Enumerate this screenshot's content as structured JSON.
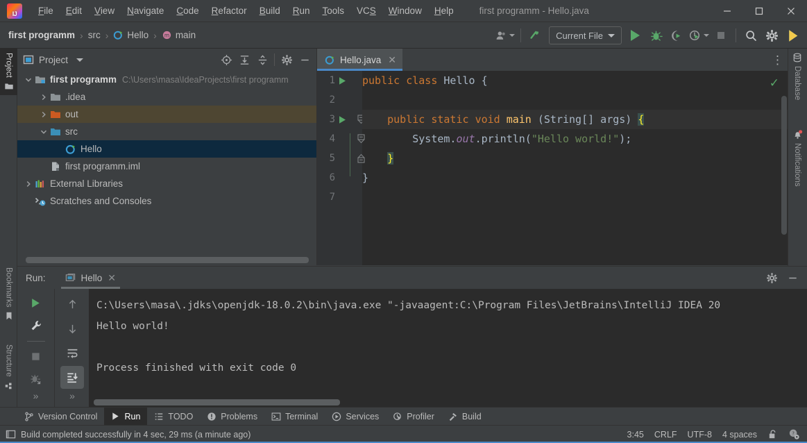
{
  "window": {
    "title": "first programm - Hello.java",
    "logo_icon": "intellij-idea-logo",
    "minimize_icon": "minimize-icon",
    "maximize_icon": "maximize-icon",
    "close_icon": "close-icon"
  },
  "menu": [
    {
      "label": "File",
      "mnemonic": "F"
    },
    {
      "label": "Edit",
      "mnemonic": "E"
    },
    {
      "label": "View",
      "mnemonic": "V"
    },
    {
      "label": "Navigate",
      "mnemonic": "N"
    },
    {
      "label": "Code",
      "mnemonic": "C"
    },
    {
      "label": "Refactor",
      "mnemonic": "R"
    },
    {
      "label": "Build",
      "mnemonic": "B"
    },
    {
      "label": "Run",
      "mnemonic": "R"
    },
    {
      "label": "Tools",
      "mnemonic": "T"
    },
    {
      "label": "VCS",
      "mnemonic": "S"
    },
    {
      "label": "Window",
      "mnemonic": "W"
    },
    {
      "label": "Help",
      "mnemonic": "H"
    }
  ],
  "breadcrumb": {
    "items": [
      "first programm",
      "src",
      "Hello",
      "main"
    ],
    "separator": "›",
    "class_icon": "java-class-icon",
    "method_icon": "method-icon"
  },
  "toolbar": {
    "user_icon": "account-icon",
    "update_icon": "update-project-icon",
    "run_config": "Current File",
    "run_icon": "run-icon",
    "debug_icon": "debug-icon",
    "run_coverage_icon": "run-with-coverage-icon",
    "profiler_icon": "profiler-icon",
    "stop_icon": "stop-icon",
    "search_icon": "search-everywhere-icon",
    "settings_icon": "settings-gear-icon",
    "ai_icon": "ide-features-icon"
  },
  "left_stripe": [
    {
      "label": "Project",
      "icon": "project-folder-icon",
      "active": true
    },
    {
      "label": "Bookmarks",
      "icon": "bookmark-icon",
      "active": false
    },
    {
      "label": "Structure",
      "icon": "structure-icon",
      "active": false
    }
  ],
  "right_stripe": [
    {
      "label": "Database",
      "icon": "database-icon"
    },
    {
      "label": "Notifications",
      "icon": "notifications-bell-icon"
    }
  ],
  "project_panel": {
    "title": "Project",
    "title_icon": "project-view-icon",
    "dropdown_icon": "chevron-down-icon",
    "actions": [
      {
        "name": "select-opened-file",
        "icon": "crosshair-icon"
      },
      {
        "name": "expand-all",
        "icon": "expand-all-icon"
      },
      {
        "name": "collapse-all",
        "icon": "collapse-all-icon"
      },
      {
        "name": "panel-settings",
        "icon": "gear-icon"
      },
      {
        "name": "hide-panel",
        "icon": "minus-icon"
      }
    ],
    "tree": [
      {
        "label": "first programm",
        "path": "C:\\Users\\masa\\IdeaProjects\\first programm",
        "indent": 0,
        "arrow": "expanded",
        "icon": "module-folder-icon",
        "bold": true,
        "state": "normal"
      },
      {
        "label": ".idea",
        "path": "",
        "indent": 1,
        "arrow": "collapsed",
        "icon": "folder-icon",
        "bold": false,
        "state": "normal"
      },
      {
        "label": "out",
        "path": "",
        "indent": 1,
        "arrow": "collapsed",
        "icon": "excluded-folder-icon",
        "bold": false,
        "state": "highlighted"
      },
      {
        "label": "src",
        "path": "",
        "indent": 1,
        "arrow": "expanded",
        "icon": "source-folder-icon",
        "bold": false,
        "state": "normal"
      },
      {
        "label": "Hello",
        "path": "",
        "indent": 2,
        "arrow": "none",
        "icon": "java-class-icon",
        "bold": false,
        "state": "selected"
      },
      {
        "label": "first programm.iml",
        "path": "",
        "indent": 1,
        "arrow": "none",
        "icon": "iml-file-icon",
        "bold": false,
        "state": "normal"
      },
      {
        "label": "External Libraries",
        "path": "",
        "indent": 0,
        "arrow": "collapsed",
        "icon": "libraries-icon",
        "bold": false,
        "state": "normal"
      },
      {
        "label": "Scratches and Consoles",
        "path": "",
        "indent": 0,
        "arrow": "none",
        "icon": "scratches-icon",
        "bold": false,
        "state": "normal"
      }
    ]
  },
  "editor": {
    "tab": {
      "label": "Hello.java",
      "icon": "java-class-icon",
      "close_icon": "close-icon"
    },
    "more_icon": "more-options-icon",
    "inspection_status_icon": "checkmark-ok-icon",
    "lines": [
      {
        "number": "1",
        "gutter_run": true,
        "fold": "none",
        "current": false,
        "tokens": [
          {
            "t": "public",
            "c": "kw"
          },
          {
            "t": " ",
            "c": ""
          },
          {
            "t": "class",
            "c": "kw"
          },
          {
            "t": " ",
            "c": ""
          },
          {
            "t": "Hello",
            "c": "cls"
          },
          {
            "t": " {",
            "c": ""
          }
        ]
      },
      {
        "number": "2",
        "gutter_run": false,
        "fold": "none",
        "current": false,
        "tokens": []
      },
      {
        "number": "3",
        "gutter_run": true,
        "fold": "start",
        "current": true,
        "tokens": [
          {
            "t": "    ",
            "c": ""
          },
          {
            "t": "public",
            "c": "kw"
          },
          {
            "t": " ",
            "c": ""
          },
          {
            "t": "static",
            "c": "kw"
          },
          {
            "t": " ",
            "c": ""
          },
          {
            "t": "void",
            "c": "kw"
          },
          {
            "t": " ",
            "c": ""
          },
          {
            "t": "main",
            "c": "mth"
          },
          {
            "t": " (String[] args) ",
            "c": ""
          },
          {
            "t": "{",
            "c": "brace-hl"
          }
        ]
      },
      {
        "number": "4",
        "gutter_run": false,
        "fold": "mid",
        "current": false,
        "tokens": [
          {
            "t": "        System.",
            "c": ""
          },
          {
            "t": "out",
            "c": "fld"
          },
          {
            "t": ".println(",
            "c": ""
          },
          {
            "t": "\"Hello world!\"",
            "c": "str"
          },
          {
            "t": ");",
            "c": ""
          }
        ]
      },
      {
        "number": "5",
        "gutter_run": false,
        "fold": "end",
        "current": false,
        "tokens": [
          {
            "t": "    ",
            "c": ""
          },
          {
            "t": "}",
            "c": "brace-hl"
          }
        ]
      },
      {
        "number": "6",
        "gutter_run": false,
        "fold": "none",
        "current": false,
        "tokens": [
          {
            "t": "}",
            "c": ""
          }
        ]
      },
      {
        "number": "7",
        "gutter_run": false,
        "fold": "none",
        "current": false,
        "tokens": []
      }
    ]
  },
  "run_panel": {
    "label": "Run:",
    "tab": {
      "label": "Hello",
      "icon": "run-config-icon",
      "close_icon": "close-icon"
    },
    "settings_icon": "gear-icon",
    "hide_icon": "minus-icon",
    "tools_left": [
      {
        "name": "rerun-button",
        "icon": "run-icon"
      },
      {
        "name": "edit-configuration-button",
        "icon": "wrench-icon"
      },
      {
        "name": "stop-button",
        "icon": "stop-icon"
      },
      {
        "name": "dump-threads-button",
        "icon": "thread-dump-icon"
      }
    ],
    "tools_right": [
      {
        "name": "previous-occurrence-button",
        "icon": "arrow-up-icon"
      },
      {
        "name": "next-occurrence-button",
        "icon": "arrow-down-icon"
      },
      {
        "name": "soft-wrap-button",
        "icon": "soft-wrap-icon"
      },
      {
        "name": "scroll-to-end-button",
        "icon": "scroll-to-end-icon",
        "active": true
      }
    ],
    "more_icon": "more-chevrons-icon",
    "console_lines": [
      "C:\\Users\\masa\\.jdks\\openjdk-18.0.2\\bin\\java.exe \"-javaagent:C:\\Program Files\\JetBrains\\IntelliJ IDEA 20",
      "Hello world!",
      "",
      "Process finished with exit code 0"
    ]
  },
  "bottom_bar": [
    {
      "label": "Version Control",
      "icon": "branch-icon",
      "active": false
    },
    {
      "label": "Run",
      "icon": "run-icon",
      "active": true
    },
    {
      "label": "TODO",
      "icon": "todo-list-icon",
      "active": false
    },
    {
      "label": "Problems",
      "icon": "problems-icon",
      "active": false
    },
    {
      "label": "Terminal",
      "icon": "terminal-icon",
      "active": false
    },
    {
      "label": "Services",
      "icon": "services-icon",
      "active": false
    },
    {
      "label": "Profiler",
      "icon": "profiler-icon",
      "active": false
    },
    {
      "label": "Build",
      "icon": "build-hammer-icon",
      "active": false
    }
  ],
  "status_bar": {
    "message_icon": "toggle-toolwindows-icon",
    "message": "Build completed successfully in 4 sec, 29 ms (a minute ago)",
    "caret_position": "3:45",
    "line_separator": "CRLF",
    "encoding": "UTF-8",
    "indent": "4 spaces",
    "lock_icon": "unlocked-icon",
    "inspection_icon": "inspection-level-icon"
  },
  "colors": {
    "bg": "#3c3f41",
    "editor_bg": "#2b2b2b",
    "accent_blue": "#4a88c7",
    "green": "#59a869",
    "selection": "#0d293e",
    "keyword": "#cc7832",
    "method": "#ffc66d",
    "string": "#6a8759",
    "field": "#9876aa"
  }
}
